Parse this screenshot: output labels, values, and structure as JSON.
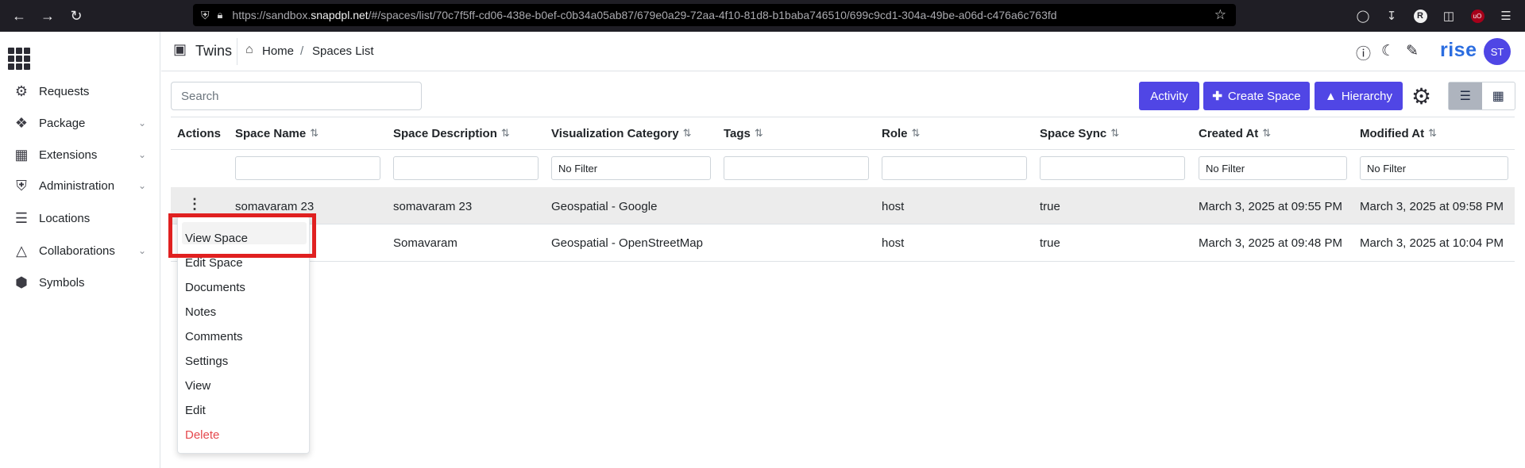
{
  "browser": {
    "url_prefix": "https://sandbox.",
    "url_domain": "snapdpl.net",
    "url_suffix": "/#/spaces/list/70c7f5ff-cd06-438e-b0ef-c0b34a05ab87/679e0a29-72aa-4f10-81d8-b1baba746510/699c9cd1-304a-49be-a06d-c476a6c763fd",
    "profile_letter": "R",
    "ublock_label": "uO"
  },
  "sidebar": {
    "items": [
      {
        "label": "Requests",
        "icon": "factory-icon",
        "has_chevron": false
      },
      {
        "label": "Package",
        "icon": "package-icon",
        "has_chevron": true
      },
      {
        "label": "Extensions",
        "icon": "extensions-icon",
        "has_chevron": true
      },
      {
        "label": "Administration",
        "icon": "shield-user-icon",
        "has_chevron": true
      },
      {
        "label": "Locations",
        "icon": "map-icon",
        "has_chevron": false
      },
      {
        "label": "Collaborations",
        "icon": "network-icon",
        "has_chevron": true
      },
      {
        "label": "Symbols",
        "icon": "cube-icon",
        "has_chevron": false
      }
    ]
  },
  "header": {
    "app_name": "Twins",
    "breadcrumb_home": "Home",
    "breadcrumb_separator": "/",
    "breadcrumb_current": "Spaces List",
    "brand": "rise",
    "avatar_initials": "ST",
    "brand_color": "#2b6de0"
  },
  "toolbar": {
    "search_placeholder": "Search",
    "activity_label": "Activity",
    "create_label": "Create Space",
    "hierarchy_label": "Hierarchy",
    "accent_color": "#5046e5"
  },
  "table": {
    "columns": [
      "Actions",
      "Space Name",
      "Space Description",
      "Visualization Category",
      "Tags",
      "Role",
      "Space Sync",
      "Created At",
      "Modified At"
    ],
    "filters": {
      "visualization_category": "No Filter",
      "created_at": "No Filter",
      "modified_at": "No Filter"
    },
    "rows": [
      {
        "name": "somavaram 23",
        "description": "somavaram 23",
        "category": "Geospatial - Google",
        "tags": "",
        "role": "host",
        "sync": "true",
        "created": "March 3, 2025 at 09:55 PM",
        "modified": "March 3, 2025 at 09:58 PM"
      },
      {
        "name": "",
        "description": "Somavaram",
        "category": "Geospatial - OpenStreetMap",
        "tags": "",
        "role": "host",
        "sync": "true",
        "created": "March 3, 2025 at 09:48 PM",
        "modified": "March 3, 2025 at 10:04 PM"
      }
    ]
  },
  "action_menu": {
    "items": [
      "View Space",
      "Edit Space",
      "Documents",
      "Notes",
      "Comments",
      "Settings",
      "View",
      "Edit",
      "Delete"
    ],
    "highlighted_item": "View Space",
    "highlight_color": "#e02020",
    "delete_color": "#e5484d"
  }
}
